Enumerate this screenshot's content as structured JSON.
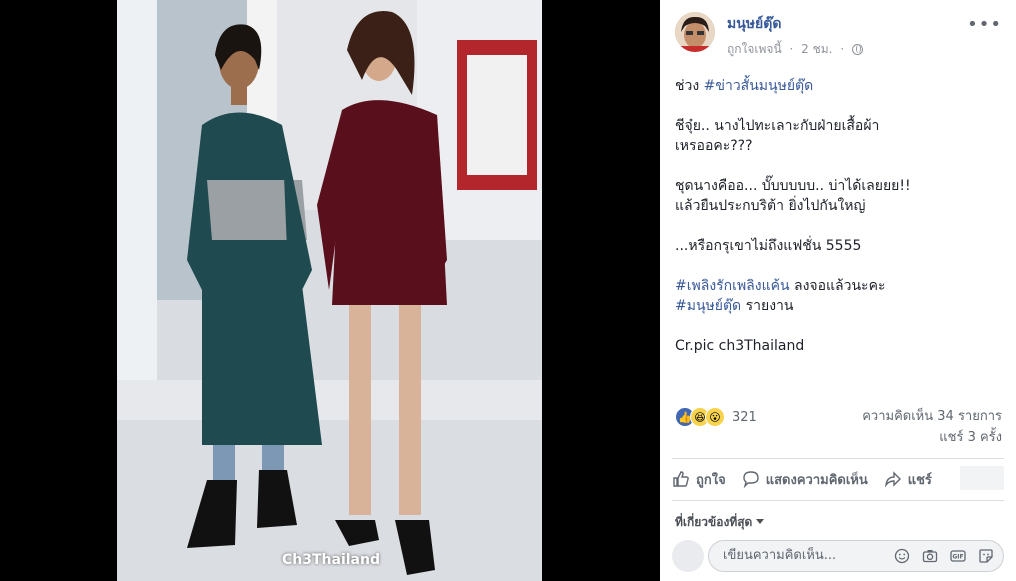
{
  "photo": {
    "watermark": "Ch3Thailand"
  },
  "post": {
    "author": "มนุษย์ตุ๊ด",
    "liked_page": "ถูกใจเพจนี้",
    "separator": "·",
    "time": "2 ชม.",
    "privacy_icon": "globe-icon",
    "menu_icon": "more-dots-icon",
    "body": [
      [
        {
          "t": "ช่วง "
        },
        {
          "t": "#ข่าวสั้นมนุษย์ตุ๊ด",
          "tag": true
        }
      ],
      [
        {
          "t": "ชีจุ๋ย.. นางไปทะเลาะกับฝ่ายเสื้อผ้า\nเหรออคะ???"
        }
      ],
      [
        {
          "t": "ชุดนางคืออ... บั๊บบบบบ.. บ่าได้เลยยย!!\nแล้วยืนประกบริต้า ยิ่งไปกันใหญ่"
        }
      ],
      [
        {
          "t": "...หรือกรุเขาไม่ถึงแฟชั่น 5555"
        }
      ],
      [
        {
          "t": "#เพลิงรักเพลิงแค้น",
          "tag": true
        },
        {
          "t": " ลงจอแล้วนะคะ\n"
        },
        {
          "t": "#มนุษย์ตุ๊ด",
          "tag": true
        },
        {
          "t": " รายงาน"
        }
      ],
      [
        {
          "t": "Cr.pic ch3Thailand"
        }
      ]
    ],
    "reactions": {
      "icons": [
        "like-reaction-icon",
        "haha-reaction-icon",
        "wow-reaction-icon"
      ],
      "count": "321"
    },
    "comments_count": "ความคิดเห็น 34 รายการ",
    "shares_count": "แชร์ 3 ครั้ง",
    "actions": {
      "like": "ถูกใจ",
      "comment": "แสดงความคิดเห็น",
      "share": "แชร์"
    },
    "sort": "ที่เกี่ยวข้องที่สุด",
    "comment_box": {
      "placeholder": "เขียนความคิดเห็น..."
    }
  },
  "colors": {
    "link": "#385898",
    "author": "#365899",
    "text": "#1d2129",
    "muted": "#606770",
    "like_blue": "#4267b2"
  }
}
